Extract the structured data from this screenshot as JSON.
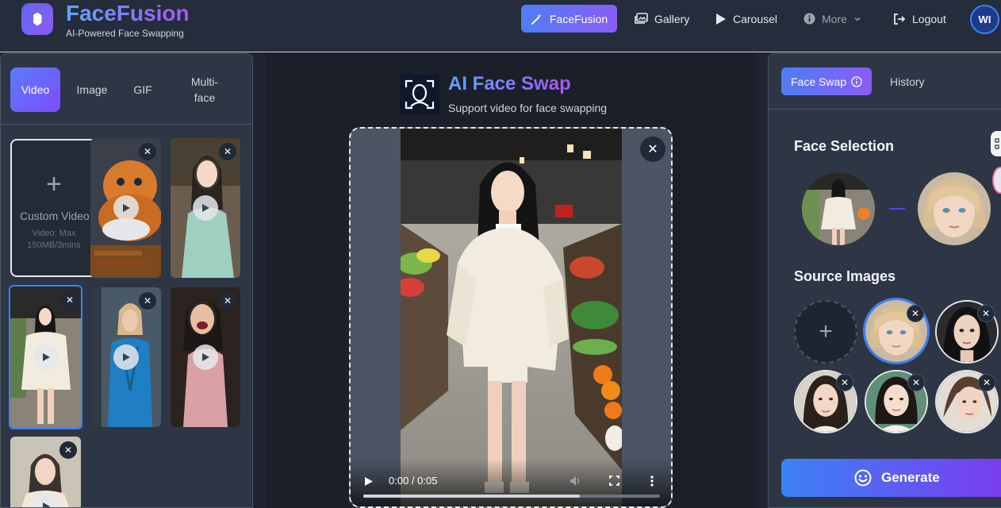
{
  "header": {
    "brand_title": "FaceFusion",
    "brand_subtitle": "AI-Powered Face Swapping",
    "nav": {
      "facefusion": "FaceFusion",
      "gallery": "Gallery",
      "carousel": "Carousel",
      "more": "More",
      "logout": "Logout"
    },
    "avatar_initials": "WI"
  },
  "left": {
    "tabs": [
      "Video",
      "Image",
      "GIF",
      "Multi-face"
    ],
    "tab_multiface_line1": "Multi-",
    "tab_multiface_line2": "face",
    "active_tab": "Video",
    "custom_video": {
      "plus": "+",
      "title": "Custom Video",
      "sub_line1": "Video: Max",
      "sub_line2": "150MB/3mins"
    },
    "remove_symbol": "✕"
  },
  "center": {
    "title": "AI Face Swap",
    "subtitle": "Support video for face swapping",
    "close_symbol": "✕",
    "player": {
      "time": "0:00 / 0:05",
      "progress_fraction": 0.73
    }
  },
  "right": {
    "tabs": {
      "face_swap": "Face Swap",
      "history": "History"
    },
    "face_selection_title": "Face Selection",
    "source_images_title": "Source Images",
    "add_symbol": "+",
    "remove_symbol": "✕",
    "generate_label": "Generate"
  },
  "colors": {
    "accent_start": "#4f7df5",
    "accent_end": "#8b5cf6",
    "background": "#1f2430",
    "panel": "#2e3646"
  }
}
